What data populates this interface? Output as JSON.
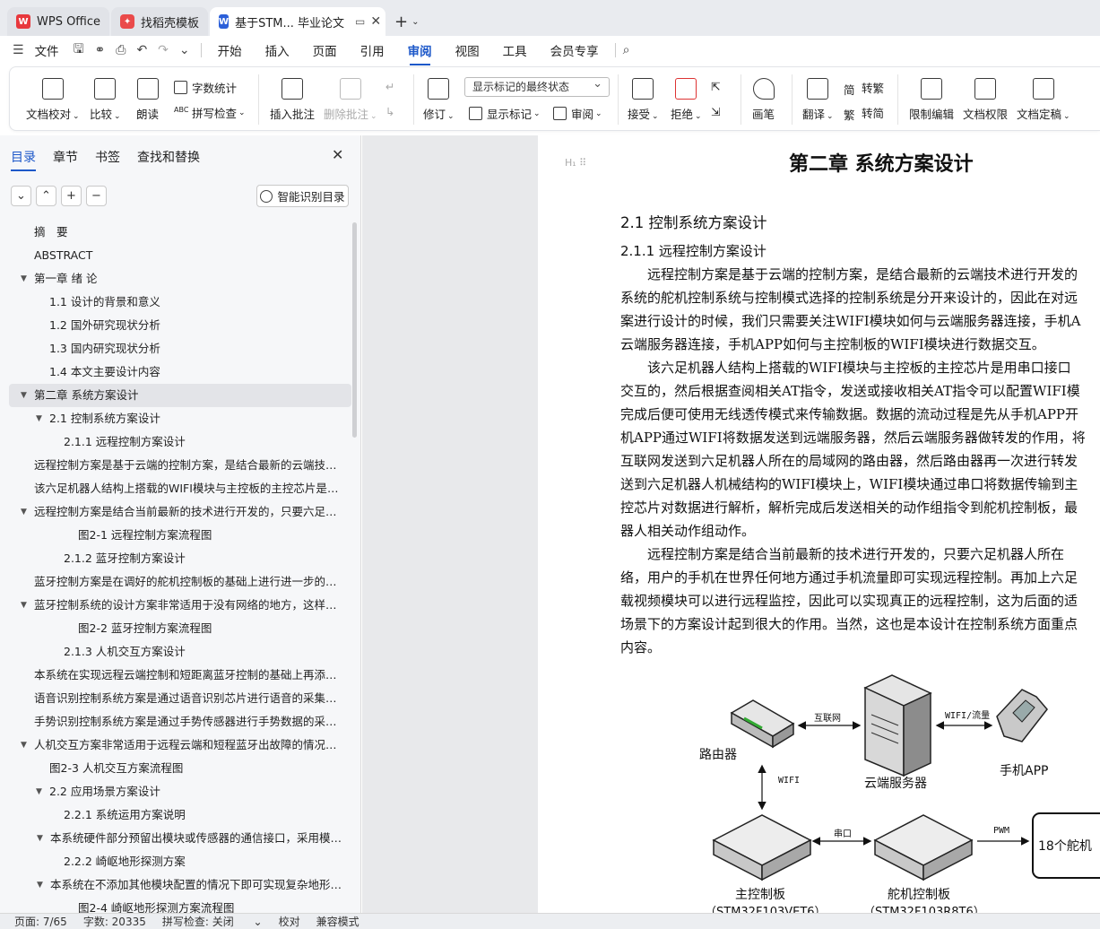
{
  "tabs": [
    {
      "label": "WPS Office",
      "icon": "wps-logo-icon"
    },
    {
      "label": "找稻壳模板",
      "icon": "daoke-logo-icon"
    },
    {
      "label": "基于STM... 毕业论文",
      "icon": "writer-logo-icon"
    }
  ],
  "menu": {
    "file": "文件",
    "items": [
      "开始",
      "插入",
      "页面",
      "引用",
      "审阅",
      "视图",
      "工具",
      "会员专享"
    ],
    "active": "审阅"
  },
  "ribbon": {
    "doc_check": "文档校对",
    "compare": "比较",
    "read_aloud": "朗读",
    "word_count": "字数统计",
    "spell_check": "拼写检查",
    "insert_comment": "插入批注",
    "delete_comment": "删除批注",
    "revise": "修订",
    "markup_select": "显示标记的最终状态",
    "show_markup": "显示标记",
    "review": "审阅",
    "accept": "接受",
    "reject": "拒绝",
    "pen": "画笔",
    "translate": "翻译",
    "to_traditional": "转繁",
    "to_simplified": "转简",
    "restrict_edit": "限制编辑",
    "doc_permission": "文档权限",
    "doc_finalize": "文档定稿"
  },
  "panel": {
    "tabs": [
      "目录",
      "章节",
      "书签",
      "查找和替换"
    ],
    "active_tab": "目录",
    "smart_button": "智能识别目录",
    "toc": [
      {
        "text": "摘　要",
        "level": 0,
        "arrow": false
      },
      {
        "text": "ABSTRACT",
        "level": 0,
        "arrow": false
      },
      {
        "text": "第一章  绪  论",
        "level": 0,
        "arrow": true
      },
      {
        "text": "1.1  设计的背景和意义",
        "level": 1,
        "arrow": false
      },
      {
        "text": "1.2  国外研究现状分析",
        "level": 1,
        "arrow": false
      },
      {
        "text": "1.3  国内研究现状分析",
        "level": 1,
        "arrow": false
      },
      {
        "text": "1.4  本文主要设计内容",
        "level": 1,
        "arrow": false
      },
      {
        "text": "第二章  系统方案设计",
        "level": 0,
        "arrow": true,
        "selected": true
      },
      {
        "text": "2.1  控制系统方案设计",
        "level": 1,
        "arrow": true
      },
      {
        "text": "2.1.1  远程控制方案设计",
        "level": 2,
        "arrow": false
      },
      {
        "text": "远程控制方案是基于云端的控制方案，是结合最新的云端技术 ...",
        "level": -1,
        "arrow": false
      },
      {
        "text": "该六足机器人结构上搭载的WIFI模块与主控板的主控芯片是用 ...",
        "level": -1,
        "arrow": false
      },
      {
        "text": "远程控制方案是结合当前最新的技术进行开发的，只要六足机 ...",
        "level": -1,
        "arrow": true
      },
      {
        "text": "图2-1  远程控制方案流程图",
        "level": 3,
        "arrow": false
      },
      {
        "text": "2.1.2  蓝牙控制方案设计",
        "level": 2,
        "arrow": false
      },
      {
        "text": "蓝牙控制方案是在调好的舵机控制板的基础上进行进一步的控 ...",
        "level": -1,
        "arrow": false
      },
      {
        "text": "蓝牙控制系统的设计方案非常适用于没有网络的地方，这样的 ...",
        "level": -1,
        "arrow": true
      },
      {
        "text": "图2-2  蓝牙控制方案流程图",
        "level": 3,
        "arrow": false
      },
      {
        "text": "2.1.3  人机交互方案设计",
        "level": 2,
        "arrow": false
      },
      {
        "text": "本系统在实现远程云端控制和短距离蓝牙控制的基础上再添加 ...",
        "level": -1,
        "arrow": false
      },
      {
        "text": "语音识别控制系统方案是通过语音识别芯片进行语音的采集， ...",
        "level": -1,
        "arrow": false
      },
      {
        "text": "手势识别控制系统方案是通过手势传感器进行手势数据的采集 ...",
        "level": -1,
        "arrow": false
      },
      {
        "text": "人机交互方案非常适用于远程云端和短程蓝牙出故障的情况或 ...",
        "level": -1,
        "arrow": true
      },
      {
        "text": "图2-3  人机交互方案流程图",
        "level": 1,
        "arrow": false
      },
      {
        "text": "2.2  应用场景方案设计",
        "level": 1,
        "arrow": true
      },
      {
        "text": "2.2.1  系统运用方案说明",
        "level": 2,
        "arrow": false
      },
      {
        "text": "本系统硬件部分预留出模块或传感器的通信接口，采用模块 ...",
        "level": -2,
        "arrow": true
      },
      {
        "text": "2.2.2  崎岖地形探测方案",
        "level": 2,
        "arrow": false
      },
      {
        "text": "本系统在不添加其他模块配置的情况下即可实现复杂地形的 ...",
        "level": -2,
        "arrow": true
      },
      {
        "text": "图2-4  崎岖地形探测方案流程图",
        "level": 3,
        "arrow": false
      }
    ]
  },
  "doc": {
    "chapter_title": "第二章  系统方案设计",
    "section": "2.1  控制系统方案设计",
    "subsection": "2.1.1  远程控制方案设计",
    "para1": [
      "　　远程控制方案是基于云端的控制方案，是结合最新的云端技术进行开发的",
      "系统的舵机控制系统与控制模式选择的控制系统是分开来设计的，因此在对远",
      "案进行设计的时候，我们只需要关注WIFI模块如何与云端服务器连接，手机A",
      "云端服务器连接，手机APP如何与主控制板的WIFI模块进行数据交互。"
    ],
    "para2": [
      "　　该六足机器人结构上搭载的WIFI模块与主控板的主控芯片是用串口接口",
      "交互的，然后根据查阅相关AT指令，发送或接收相关AT指令可以配置WIFI模",
      "完成后便可使用无线透传模式来传输数据。数据的流动过程是先从手机APP开",
      "机APP通过WIFI将数据发送到远端服务器，然后云端服务器做转发的作用，将",
      "互联网发送到六足机器人所在的局域网的路由器，然后路由器再一次进行转发",
      "送到六足机器人机械结构的WIFI模块上，WIFI模块通过串口将数据传输到主",
      "控芯片对数据进行解析，解析完成后发送相关的动作组指令到舵机控制板，最",
      "器人相关动作组动作。"
    ],
    "para3": [
      "　　远程控制方案是结合当前最新的技术进行开发的，只要六足机器人所在",
      "络，用户的手机在世界任何地方通过手机流量即可实现远程控制。再加上六足",
      "载视频模块可以进行远程监控，因此可以实现真正的远程控制，这为后面的适",
      "场景下的方案设计起到很大的作用。当然，这也是本设计在控制系统方面重点",
      "内容。"
    ],
    "diagram": {
      "router": "路由器",
      "cloud_server": "云端服务器",
      "phone_app": "手机APP",
      "main_board": "主控制板",
      "main_board_chip": "（STM32F103VET6）",
      "servo_board": "舵机控制板",
      "servo_board_chip": "（STM32F103R8T6）",
      "servos": "18个舵机",
      "link_internet": "互联网",
      "link_wifi_flow": "WIFI/流量",
      "link_wifi": "WIFI",
      "link_serial": "串口",
      "link_pwm": "PWM"
    }
  },
  "status": {
    "page": "页面: 7/65",
    "words": "字数: 20335",
    "spell": "拼写检查: 关闭",
    "proof": "校对",
    "compat": "兼容模式"
  }
}
